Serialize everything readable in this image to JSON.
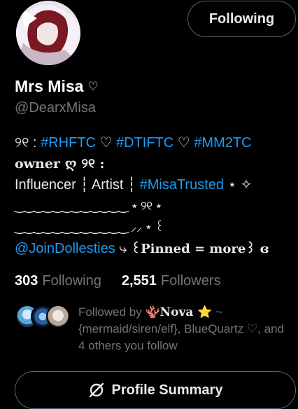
{
  "header": {
    "follow_label": "Following"
  },
  "profile": {
    "name": "Mrs Misa",
    "name_suffix": "♡",
    "handle": "@DearxMisa"
  },
  "bio": {
    "l1_a": "୨୧ : ",
    "l1_tag1": "#RHFTC",
    "l1_h1": " ♡ ",
    "l1_tag2": "#DTIFTC",
    "l1_h2": " ♡ ",
    "l1_tag3": "#MM2TC",
    "l2": "owner ღ ୨୧ :",
    "l3_a": "Influencer ┆ Artist ┆ ",
    "l3_tag": "#MisaTrusted",
    "l3_b": "  ⋆ ✧",
    "l4": "‿‿‿‿‿‿‿‿‿‿‿‿  ⋆ ୨୧ ⋆",
    "l5": "‿‿‿‿‿‿‿‿‿‿‿‿ ⸝⸝ ⋆ ꒰",
    "l6_link": "@JoinDollesties",
    "l6_arrow": " ⤷ ",
    "l6_pinned": "꒰Pinned = more꒱ ɞ"
  },
  "stats": {
    "following_count": "303",
    "following_label": "Following",
    "followers_count": "2,551",
    "followers_label": "Followers"
  },
  "followed_by": {
    "prefix": "Followed by ",
    "nova_name": "🪸Nova ⭐",
    "rest": " ~ {mermaid/siren/elf}, BlueQuartz ♡, and 4 others you follow"
  },
  "summary": {
    "label": "Profile Summary"
  },
  "colors": {
    "link": "#1d9bf0",
    "muted": "#71767b",
    "text": "#e7e9ea",
    "bg": "#000000"
  }
}
